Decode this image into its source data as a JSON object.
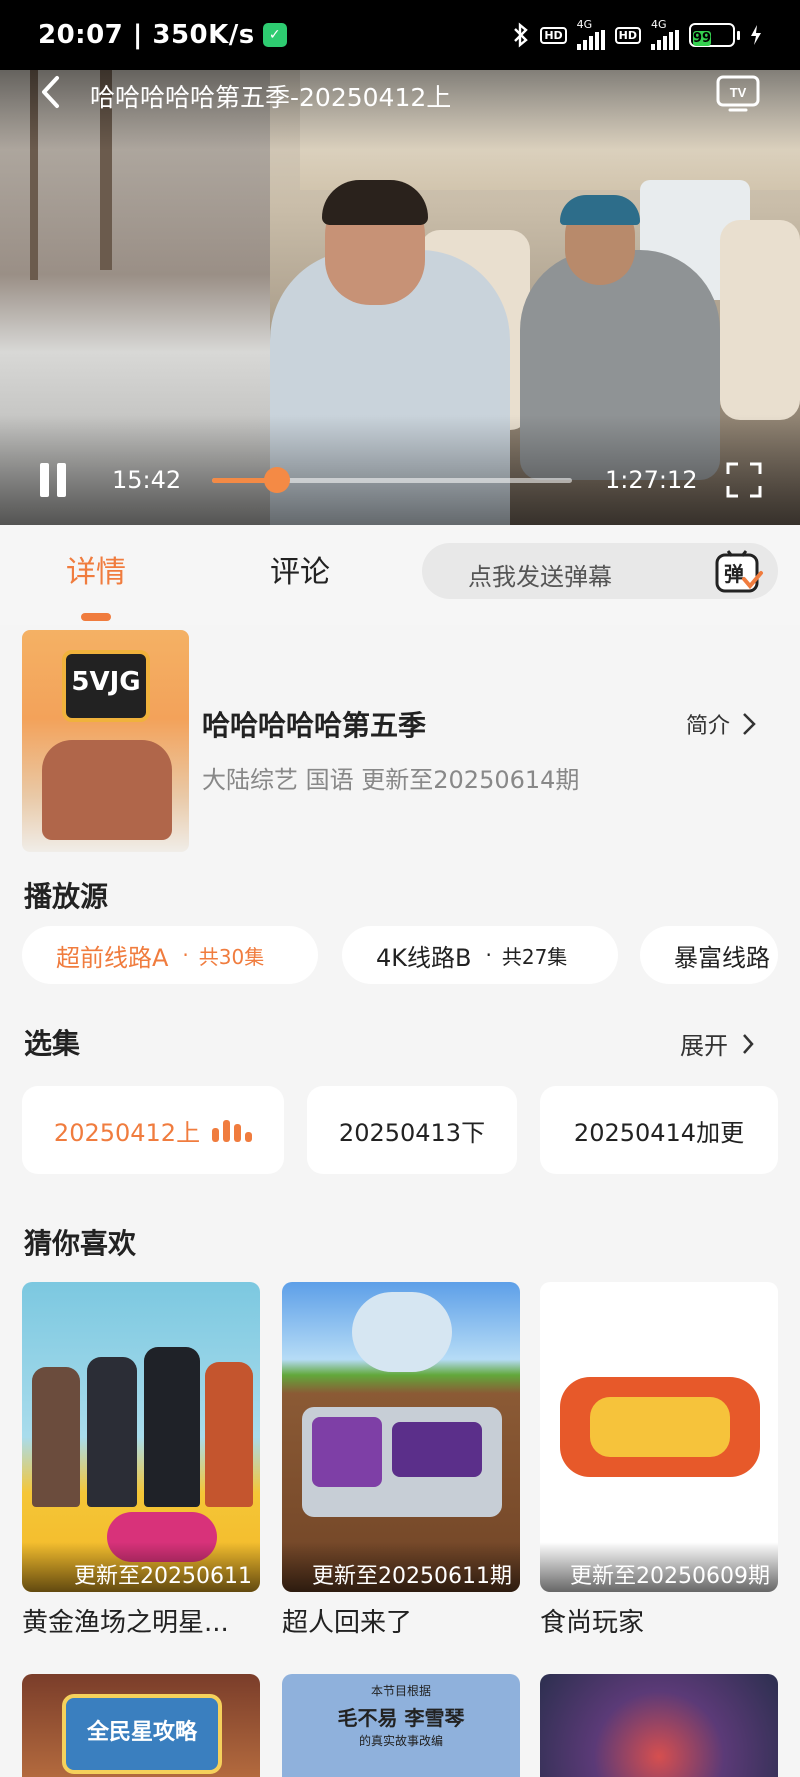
{
  "status_bar": {
    "time": "20:07 | 350K/s",
    "shield_icon": "shield-icon",
    "network_1": "4G",
    "network_2": "4G",
    "hd_1": "HD",
    "hd_2": "HD",
    "battery": "99"
  },
  "player": {
    "title": "哈哈哈哈哈第五季-20250412上",
    "current_time": "15:42",
    "total_time": "1:27:12",
    "progress_fraction": 0.18,
    "tv_label": "TV",
    "accent": "#f48a45"
  },
  "tabs": {
    "details": "详情",
    "comments": "评论",
    "danmu_placeholder": "点我发送弹幕",
    "danmu_icon_text": "弹"
  },
  "show": {
    "poster_logo": "5VJG",
    "title": "哈哈哈哈哈第五季",
    "meta": "大陆综艺 国语 更新至20250614期",
    "intro": "简介"
  },
  "sources": {
    "heading": "播放源",
    "items": [
      {
        "name": "超前线路A",
        "sep": "·",
        "count": "共30集"
      },
      {
        "name": "4K线路B",
        "sep": "·",
        "count": "共27集"
      },
      {
        "name": "暴富线路",
        "sep": "",
        "count": ""
      }
    ]
  },
  "episodes": {
    "heading": "选集",
    "expand": "展开",
    "items": [
      "20250412上",
      "20250413下",
      "20250414加更"
    ]
  },
  "recommend": {
    "heading": "猜你喜欢",
    "items": [
      {
        "update": "更新至20250611",
        "title": "黄金渔场之明星..."
      },
      {
        "update": "更新至20250611期",
        "title": "超人回来了"
      },
      {
        "update": "更新至20250609期",
        "title": "食尚玩家"
      }
    ],
    "row2_texts": [
      "全民星攻略",
      "本节目根据",
      "毛不易 李雪琴",
      "的真实故事改编"
    ]
  },
  "colors": {
    "accent": "#f07c3e",
    "background": "#f5f5f5"
  }
}
